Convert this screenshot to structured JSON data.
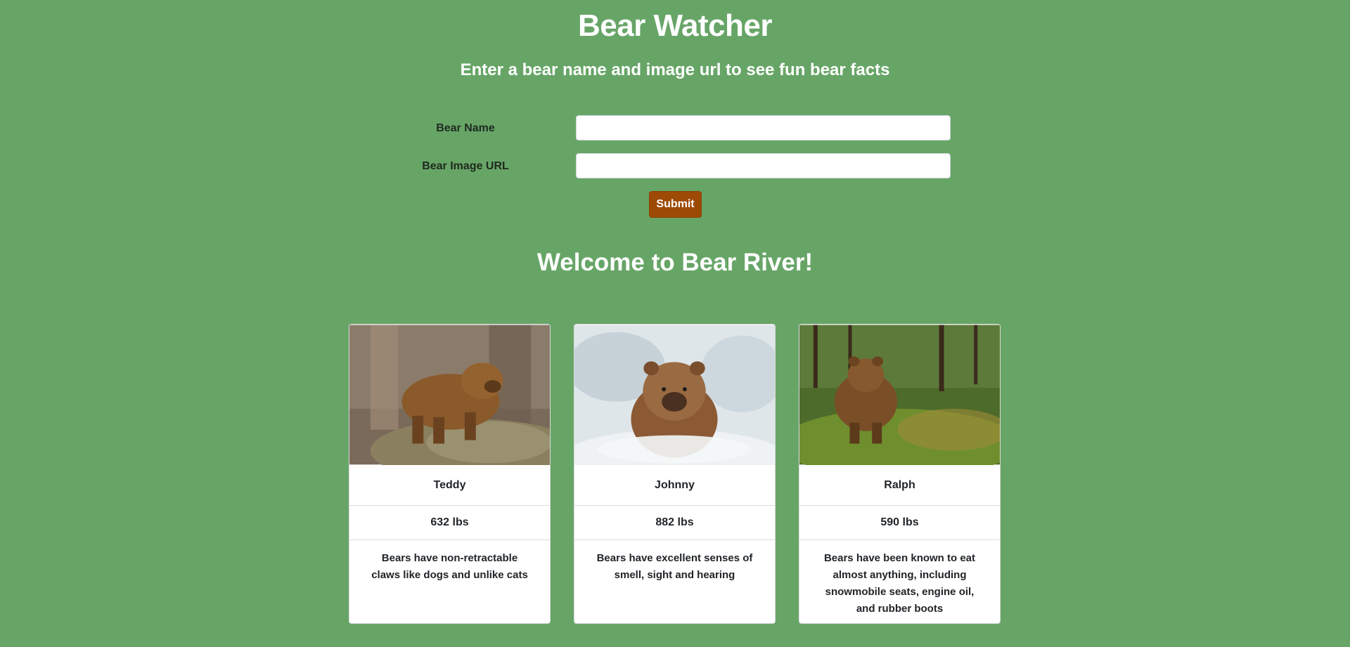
{
  "header": {
    "title": "Bear Watcher",
    "subtitle": "Enter a bear name and image url to see fun bear facts"
  },
  "form": {
    "name_label": "Bear Name",
    "name_value": "",
    "url_label": "Bear Image URL",
    "url_value": "",
    "submit_label": "Submit",
    "submit_color": "#9c4a05"
  },
  "welcome": "Welcome to Bear River!",
  "bears": [
    {
      "name": "Teddy",
      "weight": "632 lbs",
      "fact": "Bears have non-retractable claws like dogs and unlike cats",
      "image": "brown-bear-on-rock"
    },
    {
      "name": "Johnny",
      "weight": "882 lbs",
      "fact": "Bears have excellent senses of smell, sight and hearing",
      "image": "bear-in-water"
    },
    {
      "name": "Ralph",
      "weight": "590 lbs",
      "fact": "Bears have been known to eat almost anything, including snowmobile seats, engine oil, and rubber boots",
      "image": "bear-in-forest"
    }
  ],
  "colors": {
    "background": "#67a567",
    "text_light": "#ffffff"
  }
}
